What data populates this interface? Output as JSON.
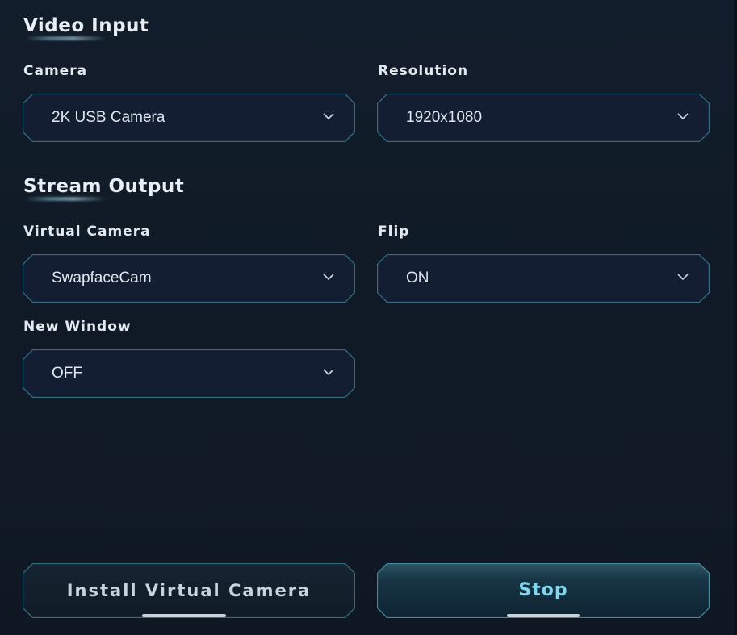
{
  "video_input": {
    "title": "Video Input",
    "camera": {
      "label": "Camera",
      "value": "2K USB Camera",
      "icon": "chevron-down-icon"
    },
    "resolution": {
      "label": "Resolution",
      "value": "1920x1080",
      "icon": "chevron-down-icon"
    }
  },
  "stream_output": {
    "title": "Stream Output",
    "virtual_camera": {
      "label": "Virtual Camera",
      "value": "SwapfaceCam",
      "icon": "chevron-down-icon"
    },
    "flip": {
      "label": "Flip",
      "value": "ON",
      "icon": "chevron-down-icon"
    },
    "new_window": {
      "label": "New Window",
      "value": "OFF",
      "icon": "chevron-down-icon"
    }
  },
  "actions": {
    "install_label": "Install Virtual Camera",
    "stop_label": "Stop"
  },
  "colors": {
    "background": "#111b28",
    "select_fill": "#141e33",
    "select_border": "#2e6f84",
    "accent_text": "#7fd8ef",
    "label_text": "#e3e8ee"
  }
}
